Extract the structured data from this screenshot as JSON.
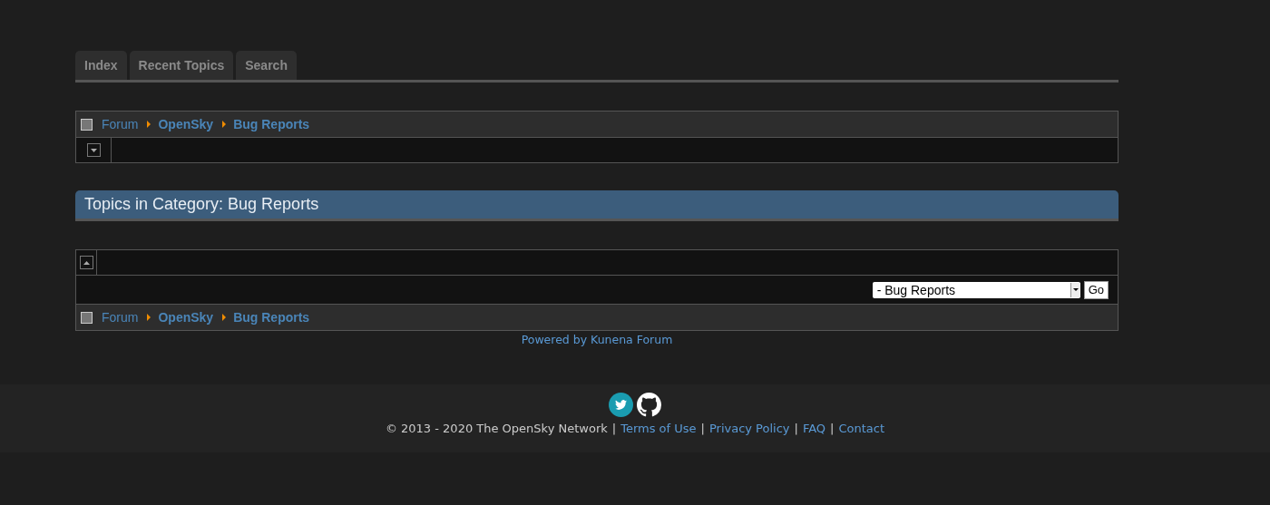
{
  "tabs": [
    {
      "label": "Index",
      "selected": false
    },
    {
      "label": "Recent Topics",
      "selected": false
    },
    {
      "label": "Search",
      "selected": false
    }
  ],
  "breadcrumb_top": [
    {
      "label": "Forum",
      "current": false
    },
    {
      "label": "OpenSky",
      "current": true
    },
    {
      "label": "Bug Reports",
      "current": true
    }
  ],
  "top_toggle": {
    "expanded": false
  },
  "section_title": "Topics in Category: Bug Reports",
  "bottom_toggle": {
    "expanded": true
  },
  "jump": {
    "value": "- Bug Reports",
    "button": "Go"
  },
  "breadcrumb_bottom": [
    {
      "label": "Forum",
      "current": false
    },
    {
      "label": "OpenSky",
      "current": true
    },
    {
      "label": "Bug Reports",
      "current": true
    }
  ],
  "powered_by": "Powered by Kunena Forum",
  "footer": {
    "copyright": "© 2013 - 2020 The OpenSky Network",
    "links": [
      "Terms of Use",
      "Privacy Policy",
      "FAQ",
      "Contact"
    ],
    "separator": "|"
  }
}
